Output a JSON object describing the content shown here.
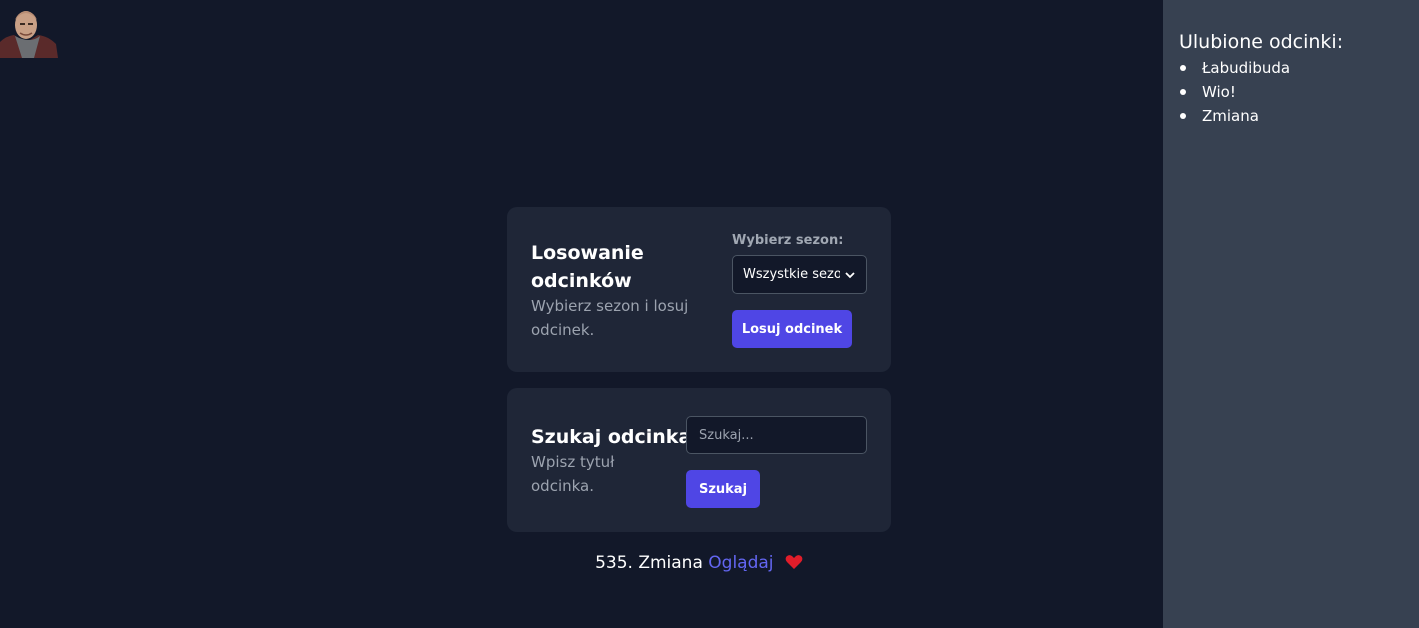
{
  "sidebar": {
    "title": "Ulubione odcinki:",
    "items": [
      {
        "label": "Łabudibuda"
      },
      {
        "label": "Wio!"
      },
      {
        "label": "Zmiana"
      }
    ]
  },
  "random_card": {
    "title_line1": "Losowanie",
    "title_line2": "odcinków",
    "desc_line1": "Wybierz sezon i losuj",
    "desc_line2": "odcinek.",
    "season_label": "Wybierz sezon:",
    "season_selected": "Wszystkie sezony",
    "button_label": "Losuj odcinek"
  },
  "search_card": {
    "title": "Szukaj odcinka",
    "desc_line1": "Wpisz tytuł",
    "desc_line2": "odcinka.",
    "placeholder": "Szukaj...",
    "button_label": "Szukaj"
  },
  "result": {
    "episode_text": "535. Zmiana",
    "watch_label": "Oglądaj"
  },
  "colors": {
    "background": "#121829",
    "card": "#1f2637",
    "sidebar": "#374151",
    "accent": "#4f46e5",
    "link": "#6366f1",
    "heart": "#e11d2a"
  },
  "icons": {
    "heart": "heart-icon",
    "select_arrow": "chevron-down-icon",
    "avatar": "avatar"
  }
}
